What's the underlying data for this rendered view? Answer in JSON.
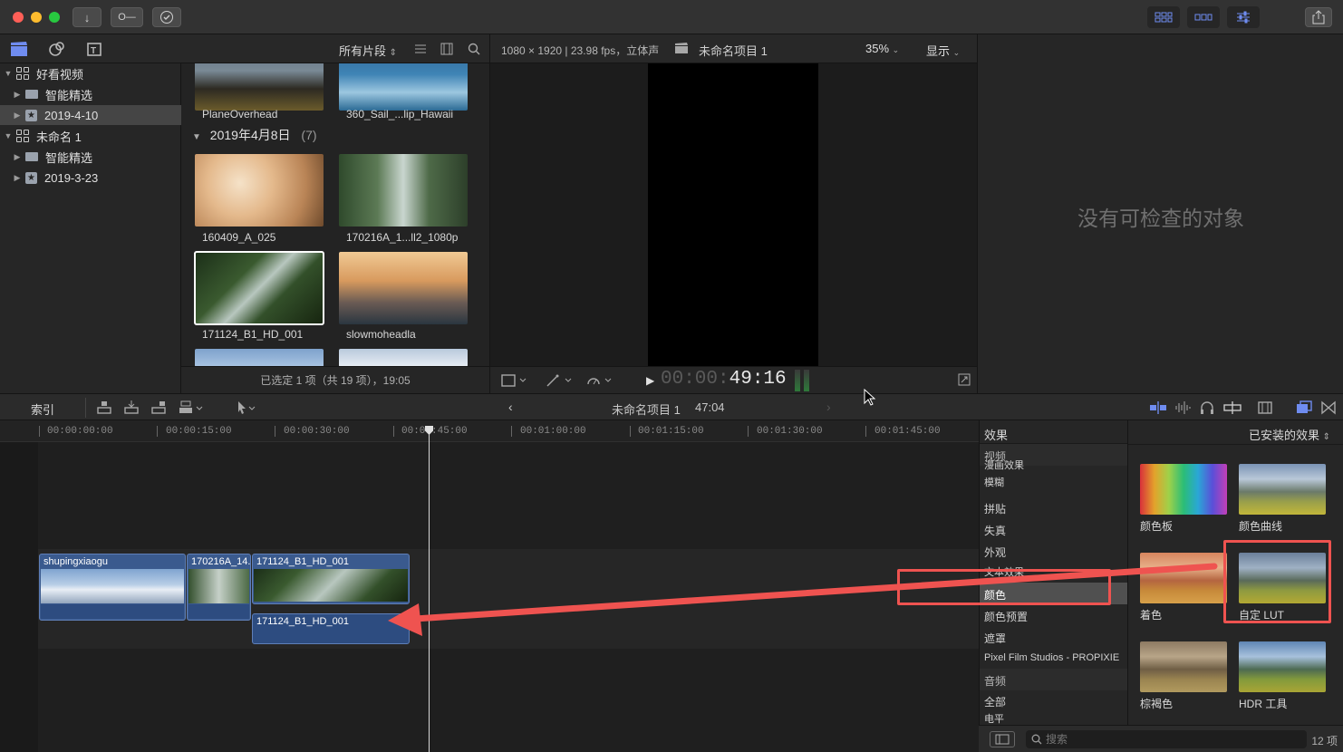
{
  "toolbar": {
    "import_icon": "download-icon",
    "keyword_icon": "key-icon",
    "check_icon": "checkmark-icon"
  },
  "library": {
    "items": [
      {
        "label": "好看视频",
        "level": 0,
        "type": "library"
      },
      {
        "label": "智能精选",
        "level": 1,
        "type": "folder"
      },
      {
        "label": "2019-4-10",
        "level": 1,
        "type": "event",
        "selected": true
      },
      {
        "label": "未命名 1",
        "level": 0,
        "type": "library"
      },
      {
        "label": "智能精选",
        "level": 1,
        "type": "folder"
      },
      {
        "label": "2019-3-23",
        "level": 1,
        "type": "event"
      }
    ]
  },
  "browser": {
    "filter": "所有片段",
    "group_title": "2019年4月8日",
    "group_count": "(7)",
    "clips": [
      {
        "name": "PlaneOverhead"
      },
      {
        "name": "360_Sail_...lip_Hawaii"
      },
      {
        "name": "160409_A_025"
      },
      {
        "name": "170216A_1...ll2_1080p"
      },
      {
        "name": "171124_B1_HD_001",
        "selected": true
      },
      {
        "name": "slowmoheadla"
      }
    ],
    "status": "已选定 1 项（共 19 项），19:05"
  },
  "viewer": {
    "format": "1080 × 1920 | 23.98 fps，立体声",
    "project": "未命名项目 1",
    "zoom": "35%",
    "display": "显示",
    "timecode_dim": "00:00:",
    "timecode": "49:16"
  },
  "inspector": {
    "empty_text": "没有可检查的对象"
  },
  "timeline": {
    "index_label": "索引",
    "project": "未命名项目 1",
    "duration": "47:04",
    "ruler": [
      "00:00:00:00",
      "00:00:15:00",
      "00:00:30:00",
      "00:00:45:00",
      "00:01:00:00",
      "00:01:15:00",
      "00:01:30:00",
      "00:01:45:00"
    ],
    "clips": [
      {
        "name": "shupingxiaogu"
      },
      {
        "name": "170216A_14..."
      },
      {
        "name": "171124_B1_HD_001"
      }
    ],
    "connected_clip": "171124_B1_HD_001"
  },
  "effects": {
    "header": "效果",
    "installed": "已安装的效果",
    "categories": [
      {
        "label": "视频",
        "header": true
      },
      {
        "label": "漫画效果"
      },
      {
        "label": "模糊"
      },
      {
        "label": "拼贴"
      },
      {
        "label": "失真"
      },
      {
        "label": "外观"
      },
      {
        "label": "文本效果"
      },
      {
        "label": "颜色",
        "selected": true
      },
      {
        "label": "颜色预置"
      },
      {
        "label": "遮罩"
      },
      {
        "label": "Pixel Film Studios - PROPIXIE"
      },
      {
        "label": "音频",
        "header": true
      },
      {
        "label": "全部"
      },
      {
        "label": "电平"
      }
    ],
    "items": [
      {
        "label": "颜色板"
      },
      {
        "label": "颜色曲线"
      },
      {
        "label": "着色"
      },
      {
        "label": "自定 LUT"
      },
      {
        "label": "棕褐色"
      },
      {
        "label": "HDR 工具"
      }
    ],
    "search_placeholder": "搜索",
    "count": "12 项"
  },
  "colors": {
    "accent": "#4a6fd8",
    "clip": "#3a5a8e",
    "annotation": "#ef5350"
  }
}
